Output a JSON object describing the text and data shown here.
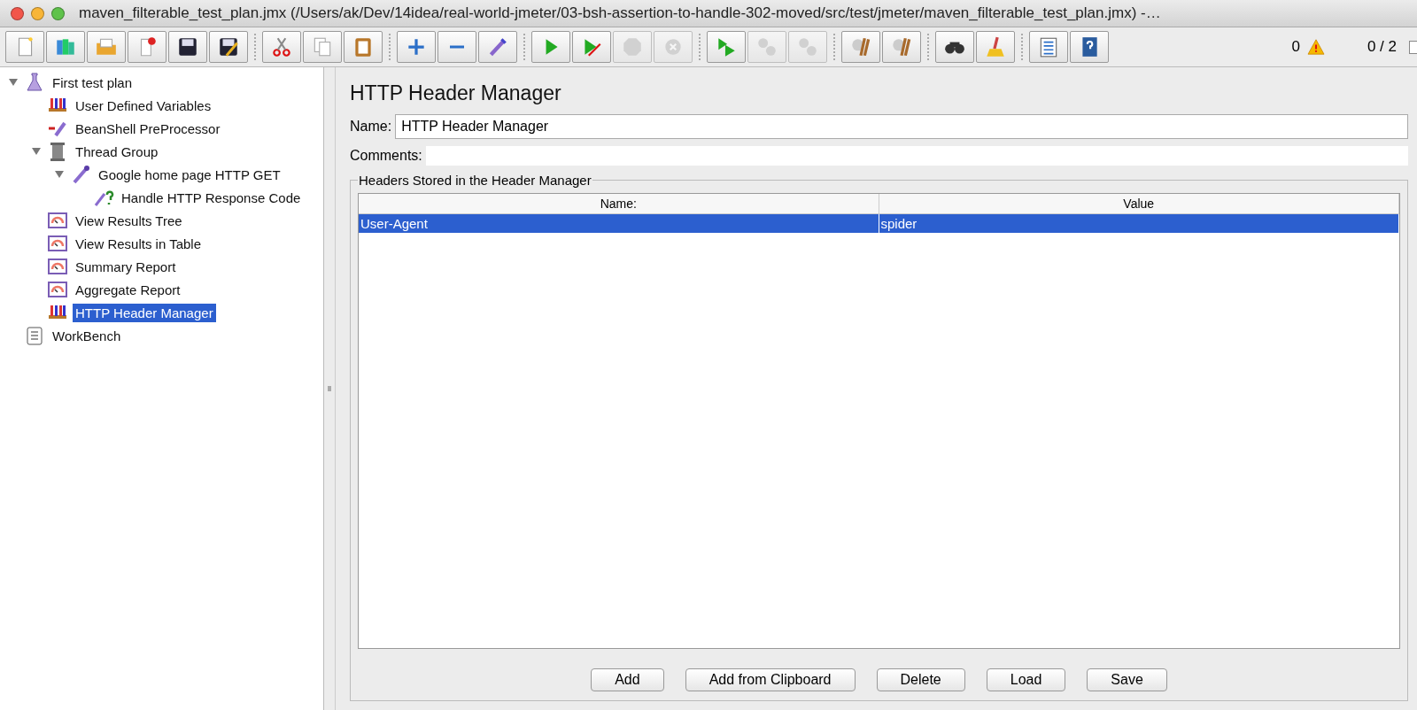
{
  "window": {
    "title": "maven_filterable_test_plan.jmx (/Users/ak/Dev/14idea/real-world-jmeter/03-bsh-assertion-to-handle-302-moved/src/test/jmeter/maven_filterable_test_plan.jmx) -…"
  },
  "toolbar": [
    [
      {
        "kind": "new",
        "disabled": false
      },
      {
        "kind": "templates",
        "disabled": false
      },
      {
        "kind": "open",
        "disabled": false
      },
      {
        "kind": "close",
        "disabled": false
      },
      {
        "kind": "save",
        "disabled": false
      },
      {
        "kind": "save-as",
        "disabled": false
      }
    ],
    [
      {
        "kind": "cut",
        "disabled": false
      },
      {
        "kind": "copy",
        "disabled": false
      },
      {
        "kind": "paste",
        "disabled": false
      }
    ],
    [
      {
        "kind": "expand",
        "disabled": false
      },
      {
        "kind": "collapse",
        "disabled": false
      },
      {
        "kind": "toggle",
        "disabled": false
      }
    ],
    [
      {
        "kind": "start",
        "disabled": false
      },
      {
        "kind": "start-no-pause",
        "disabled": false
      },
      {
        "kind": "stop",
        "disabled": true
      },
      {
        "kind": "shutdown",
        "disabled": true
      }
    ],
    [
      {
        "kind": "remote-start",
        "disabled": false
      },
      {
        "kind": "remote-stop",
        "disabled": true
      },
      {
        "kind": "remote-shutdown",
        "disabled": true
      }
    ],
    [
      {
        "kind": "clear",
        "disabled": false
      },
      {
        "kind": "clear-all",
        "disabled": false
      }
    ],
    [
      {
        "kind": "search",
        "disabled": false
      },
      {
        "kind": "reset-search",
        "disabled": false
      }
    ],
    [
      {
        "kind": "functions",
        "disabled": false
      },
      {
        "kind": "help",
        "disabled": false
      }
    ]
  ],
  "status": {
    "warnings": "0",
    "threads": "0 / 2",
    "checked": false
  },
  "tree": [
    {
      "label": "First test plan",
      "kind": "flask",
      "expanded": true,
      "selected": false,
      "children": [
        {
          "label": "User Defined Variables",
          "kind": "rack",
          "selected": false
        },
        {
          "label": "BeanShell PreProcessor",
          "kind": "dropper-arrow",
          "selected": false
        },
        {
          "label": "Thread Group",
          "kind": "spool",
          "expanded": true,
          "selected": false,
          "children": [
            {
              "label": "Google home page HTTP GET",
              "kind": "dropper",
              "expanded": true,
              "selected": false,
              "children": [
                {
                  "label": "Handle HTTP Response Code",
                  "kind": "dropper-question",
                  "selected": false
                }
              ]
            }
          ]
        },
        {
          "label": "View Results Tree",
          "kind": "gauge",
          "selected": false
        },
        {
          "label": "View Results in Table",
          "kind": "gauge",
          "selected": false
        },
        {
          "label": "Summary Report",
          "kind": "gauge",
          "selected": false
        },
        {
          "label": "Aggregate Report",
          "kind": "gauge",
          "selected": false
        },
        {
          "label": "HTTP Header Manager",
          "kind": "rack",
          "selected": true
        }
      ]
    },
    {
      "label": "WorkBench",
      "kind": "clipboard",
      "selected": false
    }
  ],
  "panel": {
    "title": "HTTP Header Manager",
    "name_label": "Name:",
    "name_value": "HTTP Header Manager",
    "comments_label": "Comments:",
    "group_title": "Headers Stored in the Header Manager",
    "table": {
      "columns": [
        "Name:",
        "Value"
      ],
      "rows": [
        {
          "cells": [
            "User-Agent",
            "spider"
          ],
          "selected": true
        }
      ]
    },
    "buttons": [
      "Add",
      "Add from Clipboard",
      "Delete",
      "Load",
      "Save"
    ]
  }
}
